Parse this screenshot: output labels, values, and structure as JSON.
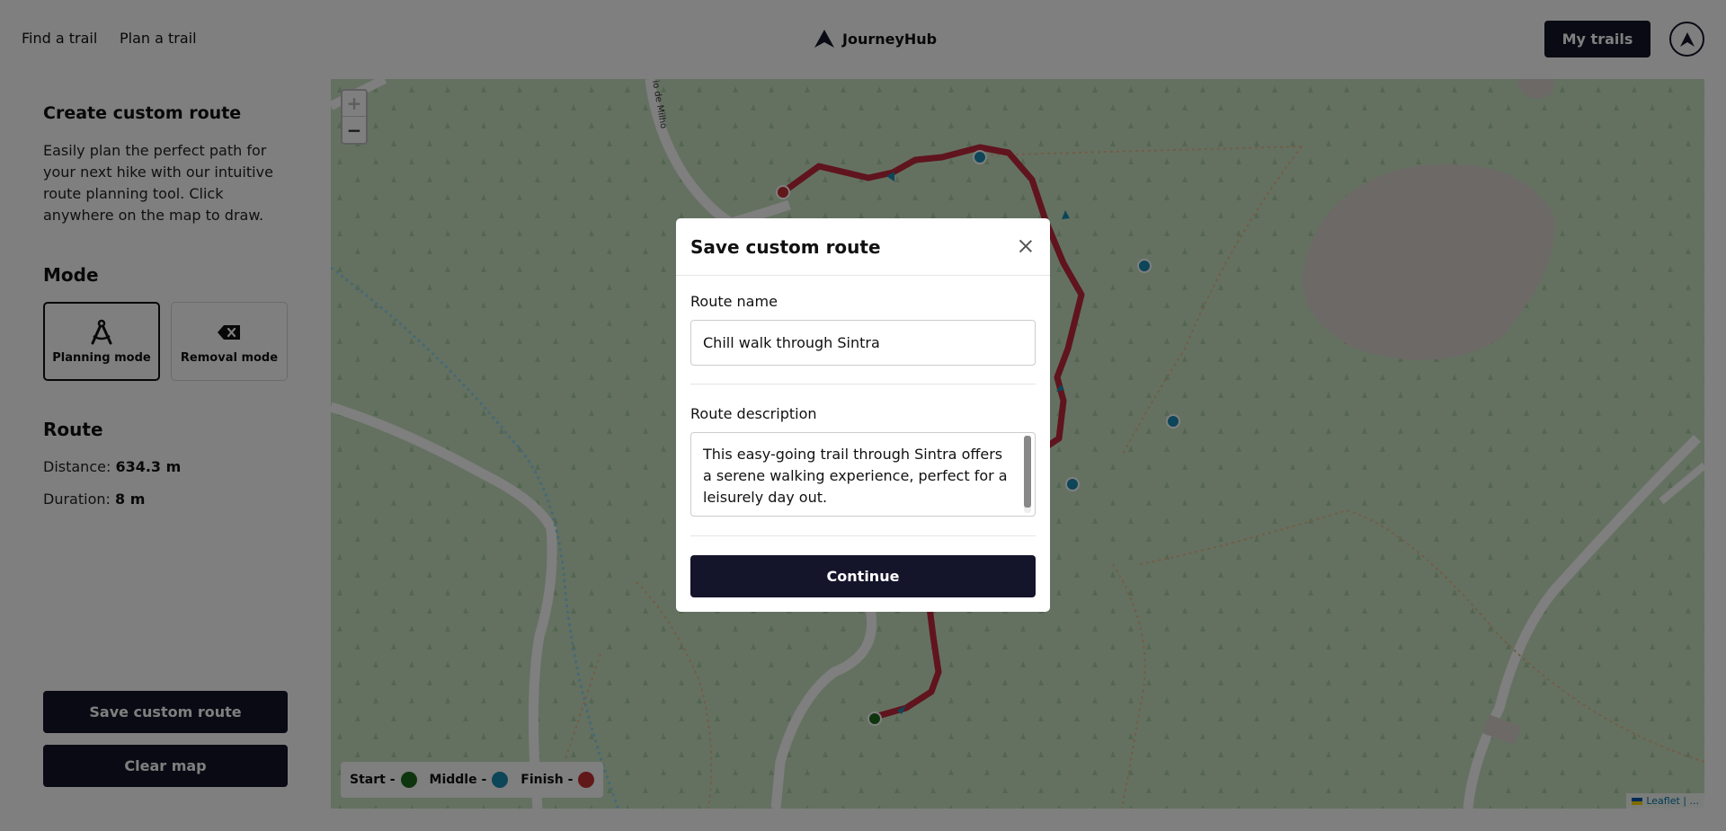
{
  "app": {
    "brand": "JourneyHub"
  },
  "nav": {
    "find": "Find a trail",
    "plan": "Plan a trail",
    "my_trails": "My trails"
  },
  "sidebar": {
    "title": "Create custom route",
    "description": "Easily plan the perfect path for your next hike with our intuitive route planning tool. Click anywhere on the map to draw.",
    "mode_heading": "Mode",
    "modes": [
      {
        "label": "Planning mode",
        "icon": "compass-drafting-icon",
        "selected": true
      },
      {
        "label": "Removal mode",
        "icon": "backspace-x-icon",
        "selected": false
      }
    ],
    "route_heading": "Route",
    "distance_label": "Distance:",
    "distance_value": "634.3 m",
    "duration_label": "Duration:",
    "duration_value": "8 m",
    "save_button": "Save custom route",
    "clear_button": "Clear map"
  },
  "map": {
    "street_label": "io de Milho",
    "zoom_in": "+",
    "zoom_out": "−",
    "legend": {
      "start": "Start -",
      "middle": "Middle -",
      "finish": "Finish -"
    },
    "attribution": "Leaflet | ...",
    "colors": {
      "start": "#1e6b1e",
      "middle": "#1a8bb3",
      "finish": "#c23030",
      "route": "#c0283a",
      "grass": "#c8e2c2"
    }
  },
  "modal": {
    "title": "Save custom route",
    "name_label": "Route name",
    "name_value": "Chill walk through Sintra",
    "description_label": "Route description",
    "description_value": "This easy-going trail through Sintra offers a serene walking experience, perfect for a leisurely day out.",
    "continue_button": "Continue"
  }
}
